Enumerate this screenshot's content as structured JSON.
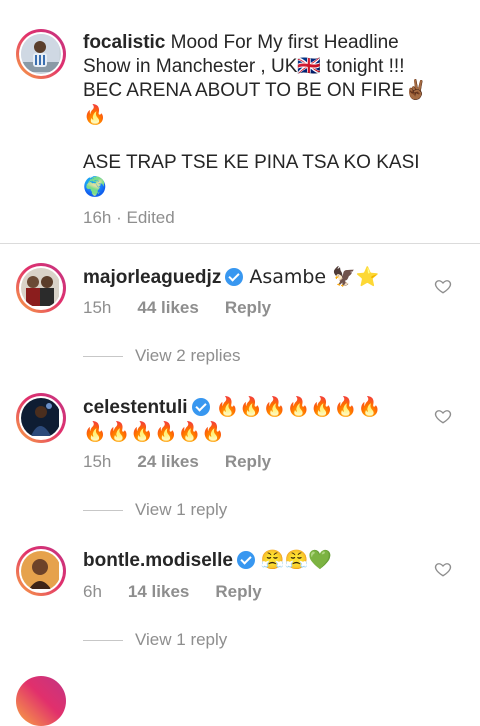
{
  "caption": {
    "username": "focalistic",
    "line1": "Mood For My first Headline",
    "line2": "Show in Manchester , UK🇬🇧 tonight !!!",
    "line3": "BEC ARENA ABOUT TO BE ON FIRE✌🏾",
    "line4": "🔥",
    "line5": "ASE TRAP TSE KE PINA TSA KO KASI",
    "line6": "🌍",
    "time": "16h",
    "edited": "· Edited"
  },
  "comments": [
    {
      "username": "majorleaguedjz",
      "text": "Asambe 🦅⭐",
      "time": "15h",
      "likes": "44 likes",
      "reply": "Reply",
      "view_replies": "View 2 replies"
    },
    {
      "username": "celestentuli",
      "text1": "🔥🔥🔥🔥🔥🔥🔥",
      "text2": "🔥🔥🔥🔥🔥🔥",
      "time": "15h",
      "likes": "24 likes",
      "reply": "Reply",
      "view_replies": "View 1 reply"
    },
    {
      "username": "bontle.modiselle",
      "text": "😤😤💚",
      "time": "6h",
      "likes": "14 likes",
      "reply": "Reply",
      "view_replies": "View 1 reply"
    }
  ],
  "colors": {
    "text": "#262626",
    "muted": "#8e8e8e",
    "verified": "#3897f0",
    "divider": "#dbdbdb"
  },
  "icons": [
    "verified-badge-icon",
    "heart-icon"
  ]
}
